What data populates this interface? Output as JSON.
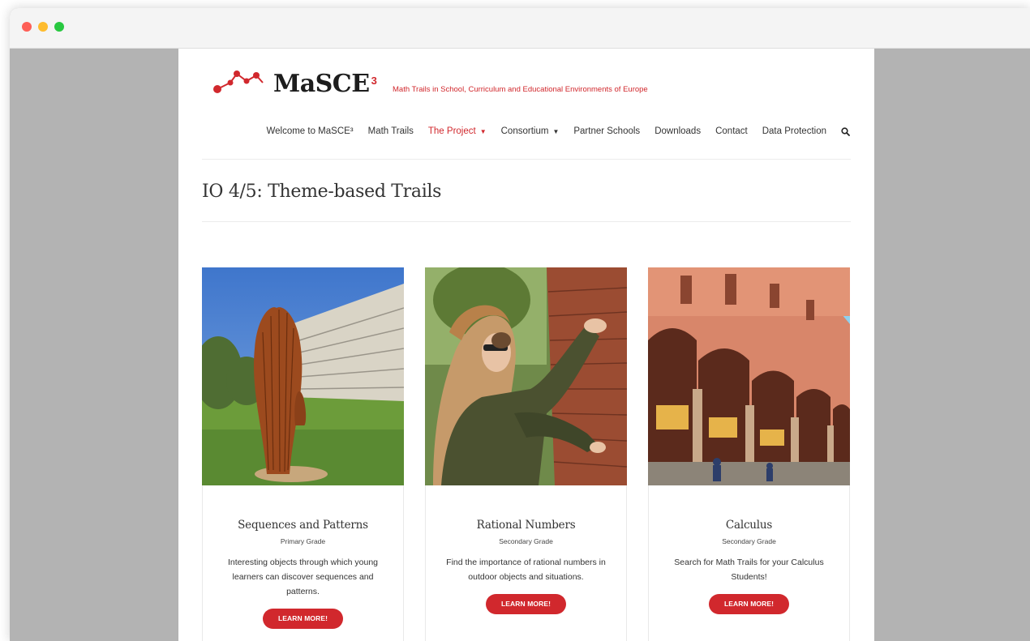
{
  "header": {
    "brand_name": "MaSCE",
    "brand_sup": "3",
    "tagline": "Math Trails in School, Curriculum and Educational Environments of Europe"
  },
  "nav": {
    "items": [
      {
        "label": "Welcome to MaSCE³",
        "dropdown": false,
        "active": false
      },
      {
        "label": "Math Trails",
        "dropdown": false,
        "active": false
      },
      {
        "label": "The Project",
        "dropdown": true,
        "active": true
      },
      {
        "label": "Consortium",
        "dropdown": true,
        "active": false
      },
      {
        "label": "Partner Schools",
        "dropdown": false,
        "active": false
      },
      {
        "label": "Downloads",
        "dropdown": false,
        "active": false
      },
      {
        "label": "Contact",
        "dropdown": false,
        "active": false
      },
      {
        "label": "Data Protection",
        "dropdown": false,
        "active": false
      }
    ],
    "search_icon": "search-icon"
  },
  "page": {
    "title": "IO 4/5: Theme-based Trails"
  },
  "cards": [
    {
      "title": "Sequences and Patterns",
      "grade": "Primary Grade",
      "description": "Interesting objects through which young learners can discover sequences and patterns.",
      "button": "LEARN MORE!"
    },
    {
      "title": "Rational Numbers",
      "grade": "Secondary Grade",
      "description": "Find the importance of rational numbers in outdoor objects and situations.",
      "button": "LEARN MORE!"
    },
    {
      "title": "Calculus",
      "grade": "Secondary Grade",
      "description": "Search for Math Trails for your Calculus Students!",
      "button": "LEARN MORE!"
    }
  ],
  "colors": {
    "accent": "#d1282d",
    "text": "#333333",
    "window_bg": "#b3b3b3"
  }
}
